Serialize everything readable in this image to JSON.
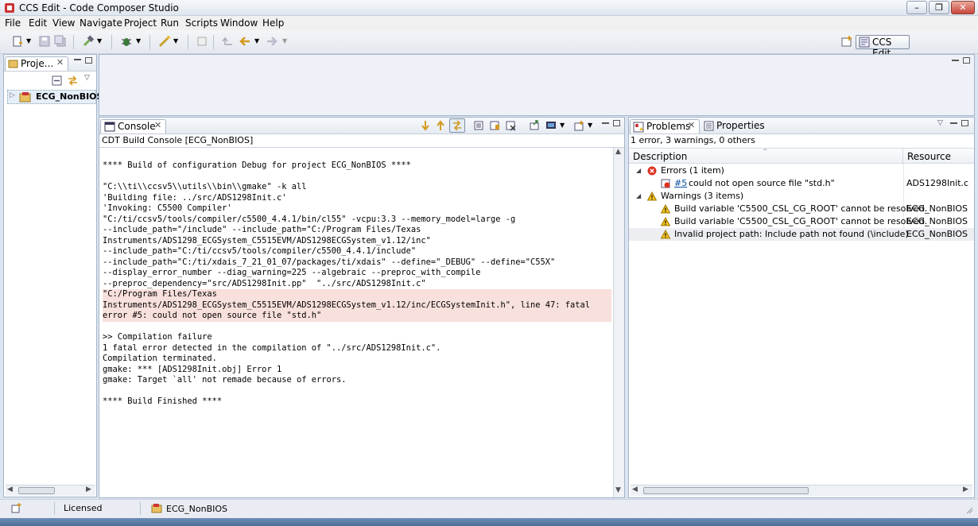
{
  "window": {
    "title": "CCS Edit - Code Composer Studio"
  },
  "menubar": {
    "items": [
      "File",
      "Edit",
      "View",
      "Navigate",
      "Project",
      "Run",
      "Scripts",
      "Window",
      "Help"
    ]
  },
  "toolbar": {
    "perspective_label": "CCS Edit"
  },
  "project_explorer": {
    "tab_label": "Proje...",
    "project_name": "ECG_NonBIOS"
  },
  "console": {
    "tab_label": "Console",
    "subtitle": "CDT Build Console [ECG_NonBIOS]",
    "lines": [
      "**** Build of configuration Debug for project ECG_NonBIOS ****",
      "",
      "\"C:\\\\ti\\\\ccsv5\\\\utils\\\\bin\\\\gmake\" -k all",
      "'Building file: ../src/ADS1298Init.c'",
      "'Invoking: C5500 Compiler'",
      "\"C:/ti/ccsv5/tools/compiler/c5500_4.4.1/bin/cl55\" -vcpu:3.3 --memory_model=large -g",
      "--include_path=\"/include\" --include_path=\"C:/Program Files/Texas",
      "Instruments/ADS1298_ECGSystem_C5515EVM/ADS1298ECGSystem_v1.12/inc\"",
      "--include_path=\"C:/ti/ccsv5/tools/compiler/c5500_4.4.1/include\"",
      "--include_path=\"C:/ti/xdais_7_21_01_07/packages/ti/xdais\" --define=\"_DEBUG\" --define=\"C55X\"",
      "--display_error_number --diag_warning=225 --algebraic --preproc_with_compile",
      "--preproc_dependency=\"src/ADS1298Init.pp\"  \"../src/ADS1298Init.c\"",
      "\"C:/Program Files/Texas",
      "Instruments/ADS1298_ECGSystem_C5515EVM/ADS1298ECGSystem_v1.12/inc/ECGSystemInit.h\", line 47: fatal",
      "error #5: could not open source file \"std.h\"",
      "",
      ">> Compilation failure",
      "1 fatal error detected in the compilation of \"../src/ADS1298Init.c\".",
      "Compilation terminated.",
      "gmake: *** [ADS1298Init.obj] Error 1",
      "gmake: Target `all' not remade because of errors.",
      "",
      "**** Build Finished ****"
    ]
  },
  "problems": {
    "tab_label": "Problems",
    "properties_tab_label": "Properties",
    "summary": "1 error, 3 warnings, 0 others",
    "col_description": "Description",
    "col_resource": "Resource",
    "errors_group": "Errors (1 item)",
    "warnings_group": "Warnings (3 items)",
    "error_items": [
      {
        "link": "#5",
        "text": "could not open source file \"std.h\"",
        "resource": "ADS1298Init.c"
      }
    ],
    "warning_items": [
      {
        "text": "Build variable 'C5500_CSL_CG_ROOT' cannot be resolved.",
        "resource": "ECG_NonBIOS"
      },
      {
        "text": "Build variable 'C5500_CSL_CG_ROOT' cannot be resolved.",
        "resource": "ECG_NonBIOS"
      },
      {
        "text": "Invalid project path: Include path not found (\\include).",
        "resource": "ECG_NonBIOS"
      }
    ]
  },
  "statusbar": {
    "license": "Licensed",
    "project": "ECG_NonBIOS"
  },
  "colors": {
    "error_highlight": "#f8e0dc",
    "accent": "#0a4da2"
  }
}
